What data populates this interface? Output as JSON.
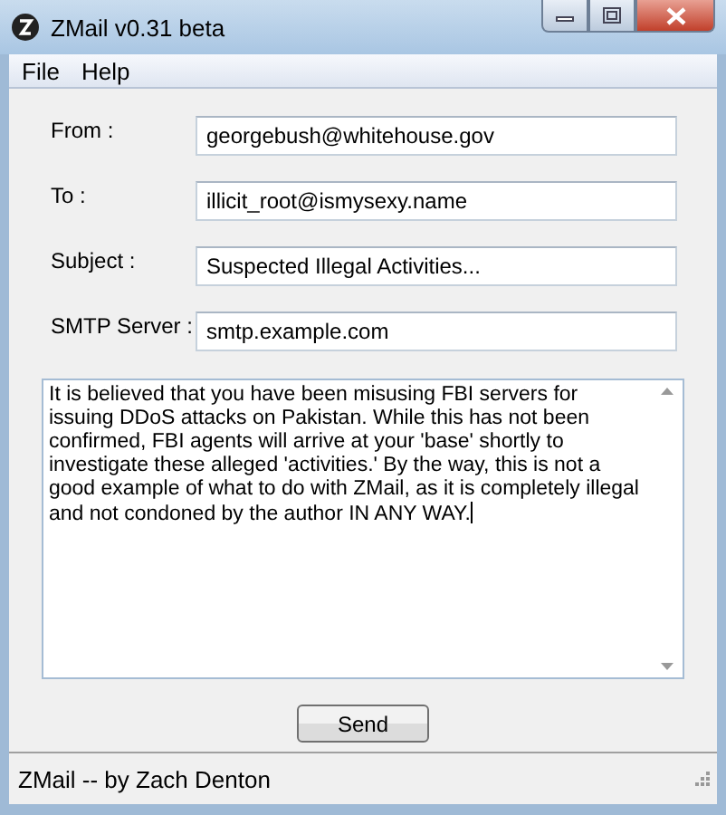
{
  "window": {
    "title": "ZMail v0.31 beta"
  },
  "menu": [
    "File",
    "Help"
  ],
  "fields": [
    {
      "label": "From :",
      "value": "georgebush@whitehouse.gov"
    },
    {
      "label": "To :",
      "value": "illicit_root@ismysexy.name"
    },
    {
      "label": "Subject :",
      "value": "Suspected Illegal Activities..."
    },
    {
      "label": "SMTP Server :",
      "value": "smtp.example.com"
    }
  ],
  "message": "It is believed that you have been misusing FBI servers for issuing DDoS attacks on Pakistan. While this has not been confirmed, FBI agents will arrive at your 'base' shortly to investigate these alleged 'activities.' By the way, this is not a good example of what to do with ZMail, as it is completely illegal and not condoned by the author IN ANY WAY.",
  "buttons": [
    "Send"
  ],
  "status_bar": "ZMail -- by Zach Denton"
}
